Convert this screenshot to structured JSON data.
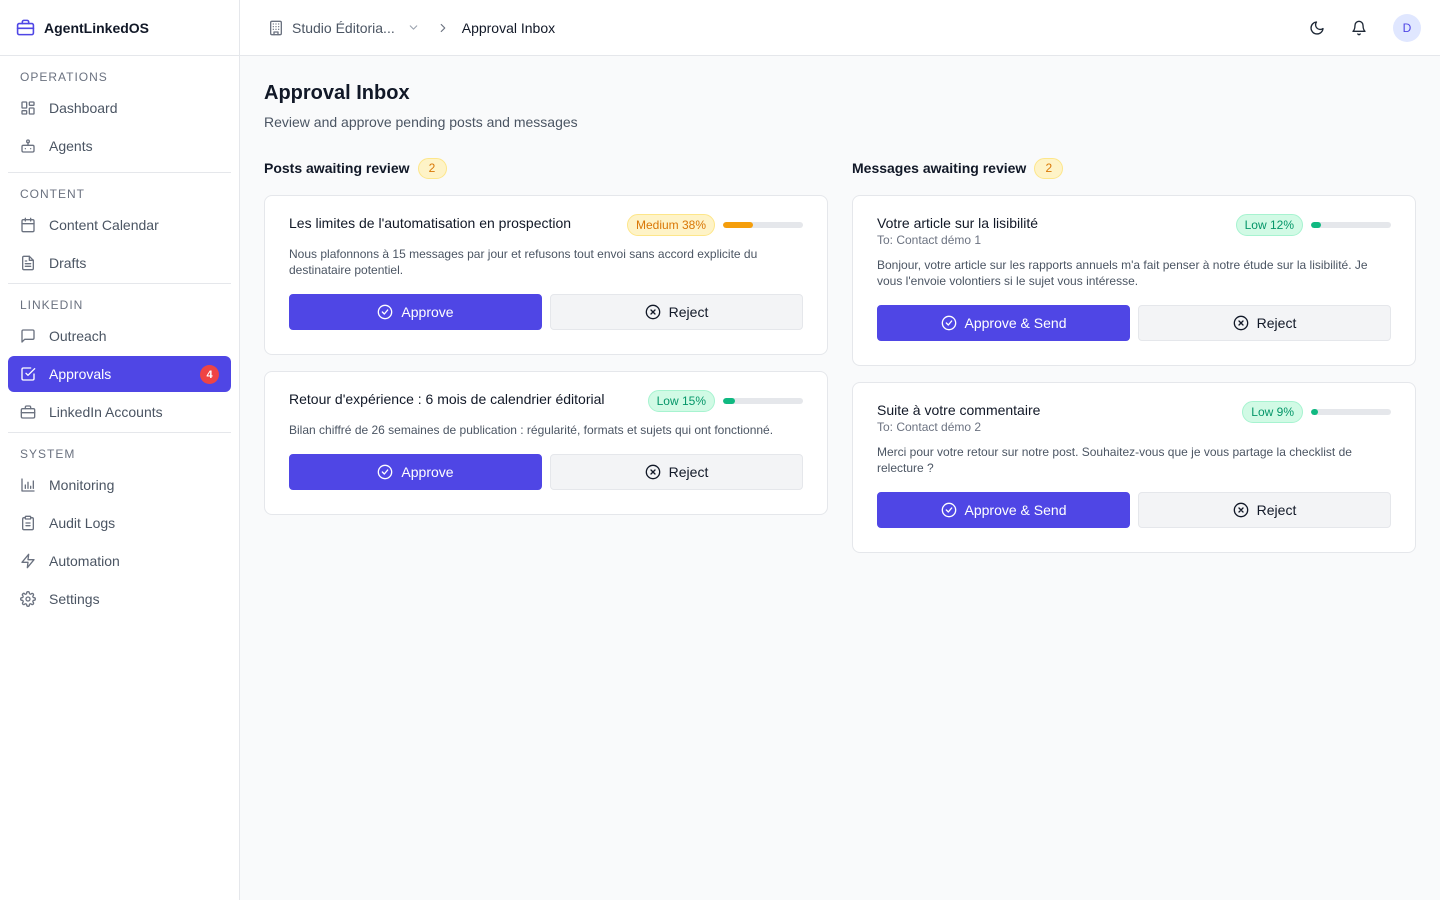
{
  "app": {
    "name": "AgentLinkedOS"
  },
  "sidebar": {
    "sections": [
      {
        "title": "OPERATIONS",
        "items": [
          {
            "label": "Dashboard",
            "icon": "dashboard-icon"
          },
          {
            "label": "Agents",
            "icon": "bot-icon"
          }
        ]
      },
      {
        "title": "CONTENT",
        "items": [
          {
            "label": "Content Calendar",
            "icon": "calendar-icon"
          },
          {
            "label": "Drafts",
            "icon": "document-icon"
          }
        ]
      },
      {
        "title": "LINKEDIN",
        "items": [
          {
            "label": "Outreach",
            "icon": "message-square-icon"
          },
          {
            "label": "Approvals",
            "icon": "check-square-icon",
            "active": true,
            "badge": "4"
          },
          {
            "label": "LinkedIn Accounts",
            "icon": "briefcase-icon"
          }
        ]
      },
      {
        "title": "SYSTEM",
        "items": [
          {
            "label": "Monitoring",
            "icon": "bar-chart-icon"
          },
          {
            "label": "Audit Logs",
            "icon": "clipboard-icon"
          },
          {
            "label": "Automation",
            "icon": "zap-icon"
          },
          {
            "label": "Settings",
            "icon": "gear-icon"
          }
        ]
      }
    ]
  },
  "topbar": {
    "org": "Studio Éditoria...",
    "current": "Approval Inbox",
    "avatar_initial": "D"
  },
  "page": {
    "title": "Approval Inbox",
    "subtitle": "Review and approve pending posts and messages"
  },
  "posts": {
    "title": "Posts awaiting review",
    "count": "2",
    "items": [
      {
        "title": "Les limites de l'automatisation en prospection",
        "risk_label": "Medium 38%",
        "risk_level": "medium",
        "risk_value": 0.38,
        "body": "Nous plafonnons à 15 messages par jour et refusons tout envoi sans accord explicite du destinataire potentiel.",
        "approve": "Approve",
        "reject": "Reject"
      },
      {
        "title": "Retour d'expérience : 6 mois de calendrier éditorial",
        "risk_label": "Low 15%",
        "risk_level": "low",
        "risk_value": 0.15,
        "body": "Bilan chiffré de 26 semaines de publication : régularité, formats et sujets qui ont fonctionné.",
        "approve": "Approve",
        "reject": "Reject"
      }
    ]
  },
  "messages": {
    "title": "Messages awaiting review",
    "count": "2",
    "items": [
      {
        "title": "Votre article sur la lisibilité",
        "to": "To: Contact démo 1",
        "risk_label": "Low 12%",
        "risk_level": "low",
        "risk_value": 0.12,
        "body": "Bonjour, votre article sur les rapports annuels m'a fait penser à notre étude sur la lisibilité. Je vous l'envoie volontiers si le sujet vous intéresse.",
        "approve": "Approve & Send",
        "reject": "Reject"
      },
      {
        "title": "Suite à votre commentaire",
        "to": "To: Contact démo 2",
        "risk_label": "Low 9%",
        "risk_level": "low",
        "risk_value": 0.09,
        "body": "Merci pour votre retour sur notre post. Souhaitez-vous que je vous partage la checklist de relecture ?",
        "approve": "Approve & Send",
        "reject": "Reject"
      }
    ]
  },
  "colors": {
    "accent": "#4f46e5",
    "low": "#10b981",
    "medium": "#f59e0b",
    "badge": "#ef4444"
  }
}
